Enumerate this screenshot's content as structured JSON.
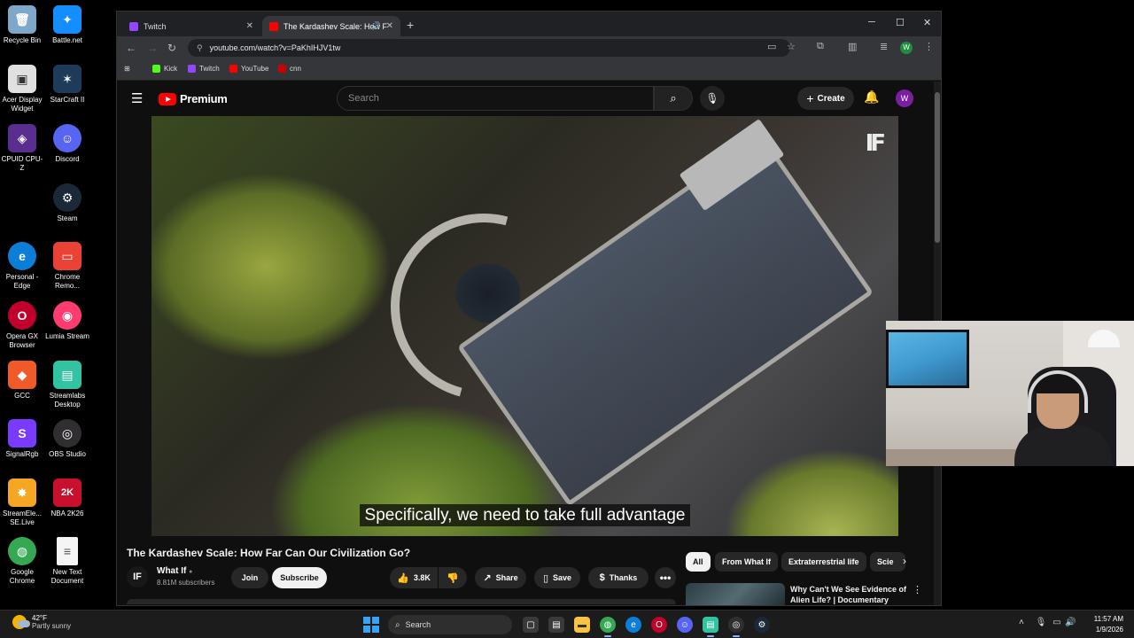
{
  "desktop": {
    "icons": [
      {
        "label": "Recycle Bin",
        "color": "#7fa7c9",
        "glyph": "🗑"
      },
      {
        "label": "Battle.net",
        "color": "#148eff",
        "glyph": "✦"
      },
      {
        "label": "Acer Display Widget",
        "color": "#e0e0e0",
        "glyph": "▣"
      },
      {
        "label": "StarCraft II",
        "color": "#1f3b5a",
        "glyph": "✶"
      },
      {
        "label": "CPUID CPU-Z",
        "color": "#5a2d91",
        "glyph": "◈"
      },
      {
        "label": "Discord",
        "color": "#5865f2",
        "glyph": "☺"
      },
      {
        "label": "Steam",
        "color": "#1b2838",
        "glyph": "⚙"
      },
      {
        "label": "Personal - Edge",
        "color": "#0c7ed7",
        "glyph": "e"
      },
      {
        "label": "Chrome Remo...",
        "color": "#ea4335",
        "glyph": "▭"
      },
      {
        "label": "Opera GX Browser",
        "color": "#c2002c",
        "glyph": "O"
      },
      {
        "label": "Lumia Stream",
        "color": "#ff3b70",
        "glyph": "◉"
      },
      {
        "label": "GCC",
        "color": "#f05a28",
        "glyph": "◆"
      },
      {
        "label": "Streamlabs Desktop",
        "color": "#31c3a2",
        "glyph": "▤"
      },
      {
        "label": "SignalRgb",
        "color": "#7a3bff",
        "glyph": "S"
      },
      {
        "label": "OBS Studio",
        "color": "#302e31",
        "glyph": "◎"
      },
      {
        "label": "StreamEle... SE.Live",
        "color": "#f5a623",
        "glyph": "✸"
      },
      {
        "label": "NBA 2K26",
        "color": "#c8102e",
        "glyph": "2K"
      },
      {
        "label": "Google Chrome",
        "color": "#34a853",
        "glyph": "◍"
      },
      {
        "label": "New Text Document",
        "color": "#f5f5f5",
        "glyph": "≡"
      }
    ]
  },
  "browser": {
    "tabs": [
      {
        "title": "Twitch",
        "favicon_color": "#9146ff"
      },
      {
        "title": "The Kardashev Scale: How F",
        "favicon_color": "#ff0000",
        "active": true
      }
    ],
    "new_tab_icon": "plus-icon",
    "window_controls": {
      "minimize": "─",
      "maximize": "☐",
      "close": "✕"
    },
    "url": "youtube.com/watch?v=PaKhIHJV1tw",
    "profile_initial": "W",
    "bookmarks": [
      {
        "label": "Kick",
        "color": "#53fc18"
      },
      {
        "label": "Twitch",
        "color": "#9146ff"
      },
      {
        "label": "YouTube",
        "color": "#ff0000"
      },
      {
        "label": "cnn",
        "color": "#cc0000"
      }
    ]
  },
  "youtube": {
    "logo_text": "Premium",
    "search_placeholder": "Search",
    "create_label": "Create",
    "avatar_initial": "W",
    "caption": "Specifically, we need to take full advantage",
    "watermark": "IF",
    "video_title": "The Kardashev Scale: How Far Can Our Civilization Go?",
    "channel": {
      "avatar": "IF",
      "name": "What If",
      "verified": "●",
      "subscribers": "8.81M subscribers"
    },
    "actions": {
      "join": "Join",
      "subscribe": "Subscribe",
      "likes": "3.8K",
      "share": "Share",
      "save": "Save",
      "thanks": "Thanks",
      "more": "•••"
    },
    "chips": [
      "All",
      "From What If",
      "Extraterrestrial life",
      "Scie"
    ],
    "recommendation": {
      "title": "Why Can't We See Evidence of Alien Life? | Documentary"
    }
  },
  "taskbar": {
    "weather": {
      "temp": "42°F",
      "desc": "Partly sunny"
    },
    "search_label": "Search",
    "clock": {
      "time": "11:57 AM",
      "date": "1/9/2026"
    },
    "apps": [
      {
        "name": "task-view",
        "color": "#3a3a3a",
        "glyph": "▢"
      },
      {
        "name": "file-explorer",
        "color": "#f6c343",
        "glyph": "▬"
      },
      {
        "name": "chrome",
        "color": "#34a853",
        "glyph": "◍",
        "active": true
      },
      {
        "name": "edge",
        "color": "#0c7ed7",
        "glyph": "e"
      },
      {
        "name": "opera-gx",
        "color": "#c2002c",
        "glyph": "O"
      },
      {
        "name": "discord",
        "color": "#5865f2",
        "glyph": "☺"
      },
      {
        "name": "streamlabs",
        "color": "#31c3a2",
        "glyph": "▤",
        "active": true
      },
      {
        "name": "obs",
        "color": "#302e31",
        "glyph": "◎",
        "active": true
      },
      {
        "name": "steam",
        "color": "#1b2838",
        "glyph": "⚙"
      }
    ]
  }
}
